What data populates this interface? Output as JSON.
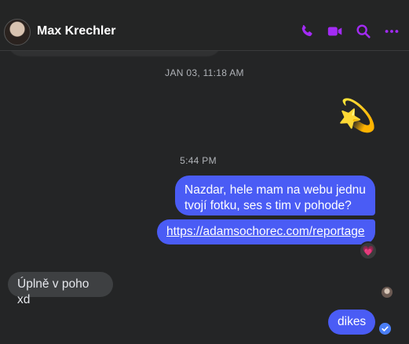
{
  "header": {
    "contact_name": "Max Krechler",
    "icons": [
      "phone-icon",
      "video-icon",
      "search-icon",
      "more-icon"
    ],
    "accent": "#a32bf5"
  },
  "messages": {
    "timestamp_1": "JAN 03, 11:18 AM",
    "emoji": "💫",
    "timestamp_2": "5:44 PM",
    "outgoing_1": "Nazdar, hele mam na webu jednu tvojí fotku, ses s tim v pohode?",
    "outgoing_link": "https://adamsochorec.com/reportage",
    "reaction": "💗",
    "incoming_1": "Úplně v poho xd",
    "outgoing_2": "dikes"
  },
  "colors": {
    "background": "#242526",
    "outgoing_bubble": "#4a5cf5",
    "incoming_bubble": "#3e4042"
  }
}
